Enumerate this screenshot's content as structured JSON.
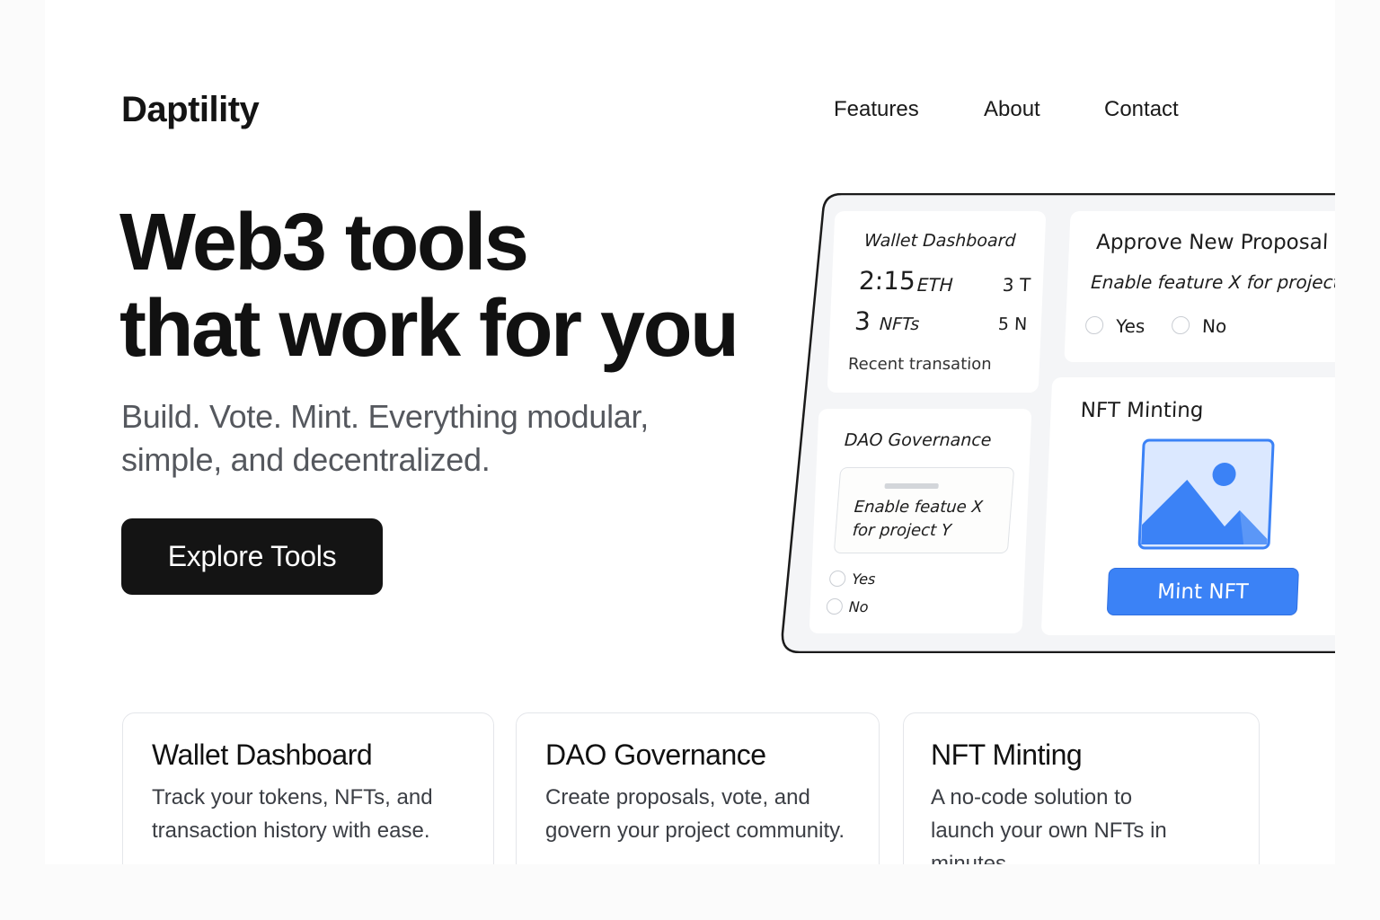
{
  "brand": {
    "logo": "Daptility"
  },
  "nav": {
    "items": [
      "Features",
      "About",
      "Contact"
    ]
  },
  "hero": {
    "title_line1": "Web3 tools",
    "title_line2": "that work for you",
    "subtitle": "Build. Vote. Mint. Everything modular, simple, and decentralized.",
    "cta_label": "Explore Tools"
  },
  "mockup": {
    "wallet": {
      "title": "Wallet Dashboard",
      "balance_value": "2:15",
      "balance_unit": "ETH",
      "tokens": "3 T",
      "nft_count": "3",
      "nft_unit": "NFTs",
      "nft_side": "5 N",
      "recent": "Recent transation"
    },
    "proposal": {
      "title": "Approve New Proposal",
      "description": "Enable feature X for project",
      "yes": "Yes",
      "no": "No"
    },
    "dao": {
      "title": "DAO Governance",
      "box_line1": "Enable featue X",
      "box_line2": "for project Y",
      "yes": "Yes",
      "no": "No"
    },
    "nft": {
      "title": "NFT Minting",
      "button": "Mint NFT",
      "image_icon": "image-placeholder-icon"
    }
  },
  "features": [
    {
      "title": "Wallet Dashboard",
      "line1": "Track your tokens, NFTs, and",
      "line2": "transaction history with ease."
    },
    {
      "title": "DAO Governance",
      "line1": "Create proposals, vote, and",
      "line2": "govern your project community."
    },
    {
      "title": "NFT Minting",
      "line1": "A no-code solution to",
      "line2": "launch your own NFTs in",
      "line3": "minutes."
    }
  ],
  "colors": {
    "accent": "#3b82f6",
    "dark": "#141414"
  }
}
